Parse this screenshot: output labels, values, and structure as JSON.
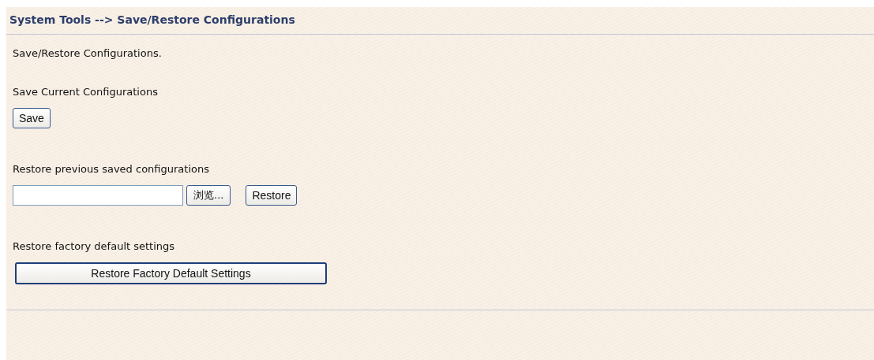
{
  "header": {
    "title": "System Tools --> Save/Restore Configurations"
  },
  "intro": "Save/Restore Configurations.",
  "sections": [
    {
      "label": "Save Current Configurations",
      "controls": [
        {
          "kind": "button",
          "label": "Save"
        }
      ]
    },
    {
      "label": "Restore previous saved configurations",
      "controls": [
        {
          "kind": "file",
          "button": "浏览..."
        },
        {
          "kind": "button",
          "label": "Restore"
        }
      ]
    },
    {
      "label": "Restore factory default settings",
      "controls": [
        {
          "kind": "wide-button",
          "label": "Restore Factory Default Settings"
        }
      ]
    }
  ]
}
